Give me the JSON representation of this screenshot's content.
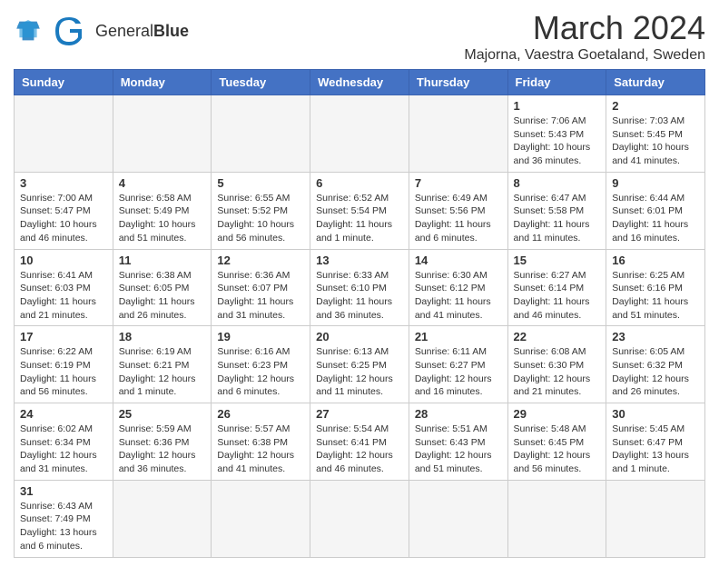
{
  "header": {
    "logo_text_normal": "General",
    "logo_text_bold": "Blue",
    "main_title": "March 2024",
    "subtitle": "Majorna, Vaestra Goetaland, Sweden"
  },
  "weekdays": [
    "Sunday",
    "Monday",
    "Tuesday",
    "Wednesday",
    "Thursday",
    "Friday",
    "Saturday"
  ],
  "weeks": [
    [
      {
        "day": "",
        "info": ""
      },
      {
        "day": "",
        "info": ""
      },
      {
        "day": "",
        "info": ""
      },
      {
        "day": "",
        "info": ""
      },
      {
        "day": "",
        "info": ""
      },
      {
        "day": "1",
        "info": "Sunrise: 7:06 AM\nSunset: 5:43 PM\nDaylight: 10 hours and 36 minutes."
      },
      {
        "day": "2",
        "info": "Sunrise: 7:03 AM\nSunset: 5:45 PM\nDaylight: 10 hours and 41 minutes."
      }
    ],
    [
      {
        "day": "3",
        "info": "Sunrise: 7:00 AM\nSunset: 5:47 PM\nDaylight: 10 hours and 46 minutes."
      },
      {
        "day": "4",
        "info": "Sunrise: 6:58 AM\nSunset: 5:49 PM\nDaylight: 10 hours and 51 minutes."
      },
      {
        "day": "5",
        "info": "Sunrise: 6:55 AM\nSunset: 5:52 PM\nDaylight: 10 hours and 56 minutes."
      },
      {
        "day": "6",
        "info": "Sunrise: 6:52 AM\nSunset: 5:54 PM\nDaylight: 11 hours and 1 minute."
      },
      {
        "day": "7",
        "info": "Sunrise: 6:49 AM\nSunset: 5:56 PM\nDaylight: 11 hours and 6 minutes."
      },
      {
        "day": "8",
        "info": "Sunrise: 6:47 AM\nSunset: 5:58 PM\nDaylight: 11 hours and 11 minutes."
      },
      {
        "day": "9",
        "info": "Sunrise: 6:44 AM\nSunset: 6:01 PM\nDaylight: 11 hours and 16 minutes."
      }
    ],
    [
      {
        "day": "10",
        "info": "Sunrise: 6:41 AM\nSunset: 6:03 PM\nDaylight: 11 hours and 21 minutes."
      },
      {
        "day": "11",
        "info": "Sunrise: 6:38 AM\nSunset: 6:05 PM\nDaylight: 11 hours and 26 minutes."
      },
      {
        "day": "12",
        "info": "Sunrise: 6:36 AM\nSunset: 6:07 PM\nDaylight: 11 hours and 31 minutes."
      },
      {
        "day": "13",
        "info": "Sunrise: 6:33 AM\nSunset: 6:10 PM\nDaylight: 11 hours and 36 minutes."
      },
      {
        "day": "14",
        "info": "Sunrise: 6:30 AM\nSunset: 6:12 PM\nDaylight: 11 hours and 41 minutes."
      },
      {
        "day": "15",
        "info": "Sunrise: 6:27 AM\nSunset: 6:14 PM\nDaylight: 11 hours and 46 minutes."
      },
      {
        "day": "16",
        "info": "Sunrise: 6:25 AM\nSunset: 6:16 PM\nDaylight: 11 hours and 51 minutes."
      }
    ],
    [
      {
        "day": "17",
        "info": "Sunrise: 6:22 AM\nSunset: 6:19 PM\nDaylight: 11 hours and 56 minutes."
      },
      {
        "day": "18",
        "info": "Sunrise: 6:19 AM\nSunset: 6:21 PM\nDaylight: 12 hours and 1 minute."
      },
      {
        "day": "19",
        "info": "Sunrise: 6:16 AM\nSunset: 6:23 PM\nDaylight: 12 hours and 6 minutes."
      },
      {
        "day": "20",
        "info": "Sunrise: 6:13 AM\nSunset: 6:25 PM\nDaylight: 12 hours and 11 minutes."
      },
      {
        "day": "21",
        "info": "Sunrise: 6:11 AM\nSunset: 6:27 PM\nDaylight: 12 hours and 16 minutes."
      },
      {
        "day": "22",
        "info": "Sunrise: 6:08 AM\nSunset: 6:30 PM\nDaylight: 12 hours and 21 minutes."
      },
      {
        "day": "23",
        "info": "Sunrise: 6:05 AM\nSunset: 6:32 PM\nDaylight: 12 hours and 26 minutes."
      }
    ],
    [
      {
        "day": "24",
        "info": "Sunrise: 6:02 AM\nSunset: 6:34 PM\nDaylight: 12 hours and 31 minutes."
      },
      {
        "day": "25",
        "info": "Sunrise: 5:59 AM\nSunset: 6:36 PM\nDaylight: 12 hours and 36 minutes."
      },
      {
        "day": "26",
        "info": "Sunrise: 5:57 AM\nSunset: 6:38 PM\nDaylight: 12 hours and 41 minutes."
      },
      {
        "day": "27",
        "info": "Sunrise: 5:54 AM\nSunset: 6:41 PM\nDaylight: 12 hours and 46 minutes."
      },
      {
        "day": "28",
        "info": "Sunrise: 5:51 AM\nSunset: 6:43 PM\nDaylight: 12 hours and 51 minutes."
      },
      {
        "day": "29",
        "info": "Sunrise: 5:48 AM\nSunset: 6:45 PM\nDaylight: 12 hours and 56 minutes."
      },
      {
        "day": "30",
        "info": "Sunrise: 5:45 AM\nSunset: 6:47 PM\nDaylight: 13 hours and 1 minute."
      }
    ],
    [
      {
        "day": "31",
        "info": "Sunrise: 6:43 AM\nSunset: 7:49 PM\nDaylight: 13 hours and 6 minutes."
      },
      {
        "day": "",
        "info": ""
      },
      {
        "day": "",
        "info": ""
      },
      {
        "day": "",
        "info": ""
      },
      {
        "day": "",
        "info": ""
      },
      {
        "day": "",
        "info": ""
      },
      {
        "day": "",
        "info": ""
      }
    ]
  ]
}
